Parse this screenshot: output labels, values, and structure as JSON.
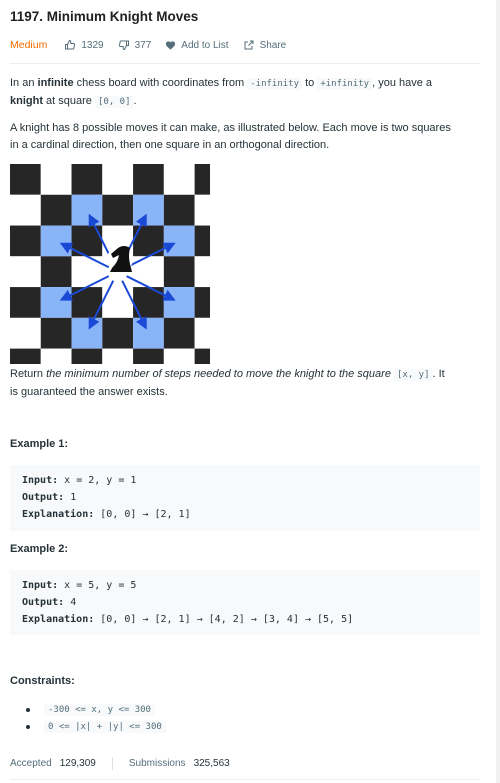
{
  "problem": {
    "title": "1197. Minimum Knight Moves",
    "difficulty": "Medium",
    "likes": "1329",
    "dislikes": "377",
    "add_to_list": "Add to List",
    "share": "Share"
  },
  "description": {
    "p1": {
      "t1": "In an ",
      "t2": "infinite",
      "t3": " chess board with coordinates from ",
      "c1": "-infinity",
      "t4": " to ",
      "c2": "+infinity",
      "t5": ", you have a",
      "t6": "knight",
      "t7": " at square ",
      "c3": "[0, 0]",
      "t8": "."
    },
    "p2_line1": "A knight has 8 possible moves it can make, as illustrated below. Each move is two squares",
    "p2_line2": "in a cardinal direction, then one square in an orthogonal direction.",
    "p3": {
      "t1": "Return ",
      "t2": "the minimum number of steps needed to move the knight to the square ",
      "c1": "[x, y]",
      "t3": ". It",
      "t4": "is guaranteed the answer exists."
    }
  },
  "colors": {
    "dark": "#262626",
    "light": "#ffffff",
    "highlight": "#8ab4f8",
    "arrow": "#1a49d6",
    "difficulty": "#ef6c00"
  },
  "examples": [
    {
      "heading": "Example 1:",
      "input_label": "Input:",
      "input": "x = 2, y = 1",
      "output_label": "Output:",
      "output": "1",
      "explanation_label": "Explanation:",
      "explanation": "[0, 0] → [2, 1]"
    },
    {
      "heading": "Example 2:",
      "input_label": "Input:",
      "input": "x = 5, y = 5",
      "output_label": "Output:",
      "output": "4",
      "explanation_label": "Explanation:",
      "explanation": "[0, 0] → [2, 1] → [4, 2] → [3, 4] → [5, 5]"
    }
  ],
  "constraints": {
    "heading": "Constraints:",
    "items": [
      "-300 <= x, y <= 300",
      "0 <= |x| + |y| <= 300"
    ]
  },
  "stats": {
    "accepted_label": "Accepted",
    "accepted": "129,309",
    "submissions_label": "Submissions",
    "submissions": "325,563"
  }
}
